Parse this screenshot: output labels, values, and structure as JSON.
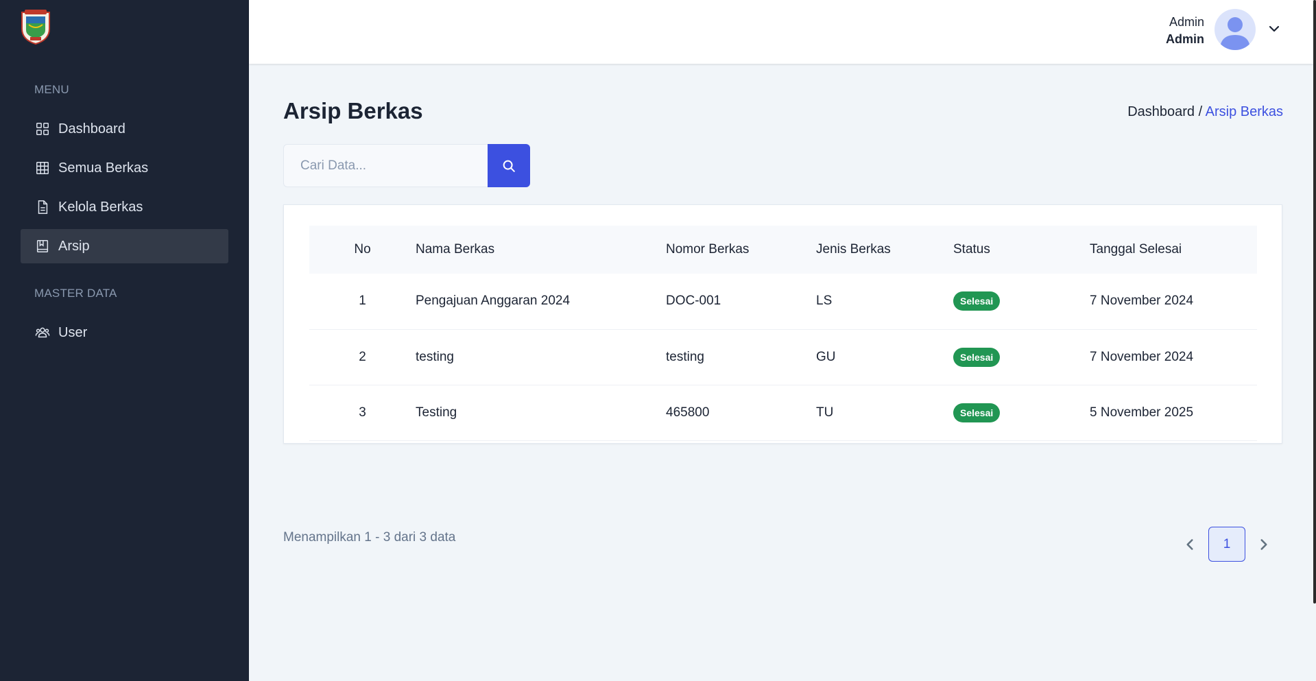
{
  "sidebar": {
    "menu_heading": "MENU",
    "items": [
      {
        "label": "Dashboard",
        "icon": "grid-icon"
      },
      {
        "label": "Semua Berkas",
        "icon": "table-icon"
      },
      {
        "label": "Kelola Berkas",
        "icon": "document-icon"
      },
      {
        "label": "Arsip",
        "icon": "archive-icon",
        "active": true
      }
    ],
    "master_heading": "MASTER DATA",
    "master_items": [
      {
        "label": "User",
        "icon": "users-icon"
      }
    ]
  },
  "header": {
    "user_name": "Admin",
    "user_role": "Admin"
  },
  "page": {
    "title": "Arsip Berkas",
    "breadcrumb_home": "Dashboard /",
    "breadcrumb_current": "Arsip Berkas"
  },
  "search": {
    "placeholder": "Cari Data..."
  },
  "table": {
    "headers": [
      "No",
      "Nama Berkas",
      "Nomor Berkas",
      "Jenis Berkas",
      "Status",
      "Tanggal Selesai"
    ],
    "rows": [
      {
        "no": "1",
        "nama": "Pengajuan Anggaran 2024",
        "nomor": "DOC-001",
        "jenis": "LS",
        "status": "Selesai",
        "tanggal": "7 November 2024"
      },
      {
        "no": "2",
        "nama": "testing",
        "nomor": "testing",
        "jenis": "GU",
        "status": "Selesai",
        "tanggal": "7 November 2024"
      },
      {
        "no": "3",
        "nama": "Testing",
        "nomor": "465800",
        "jenis": "TU",
        "status": "Selesai",
        "tanggal": "5 November 2025"
      }
    ]
  },
  "pagination": {
    "summary": "Menampilkan 1 - 3 dari 3 data",
    "current_page": "1"
  },
  "colors": {
    "sidebar_bg": "#1c2434",
    "accent": "#3c50e0",
    "status_success": "#219653"
  }
}
